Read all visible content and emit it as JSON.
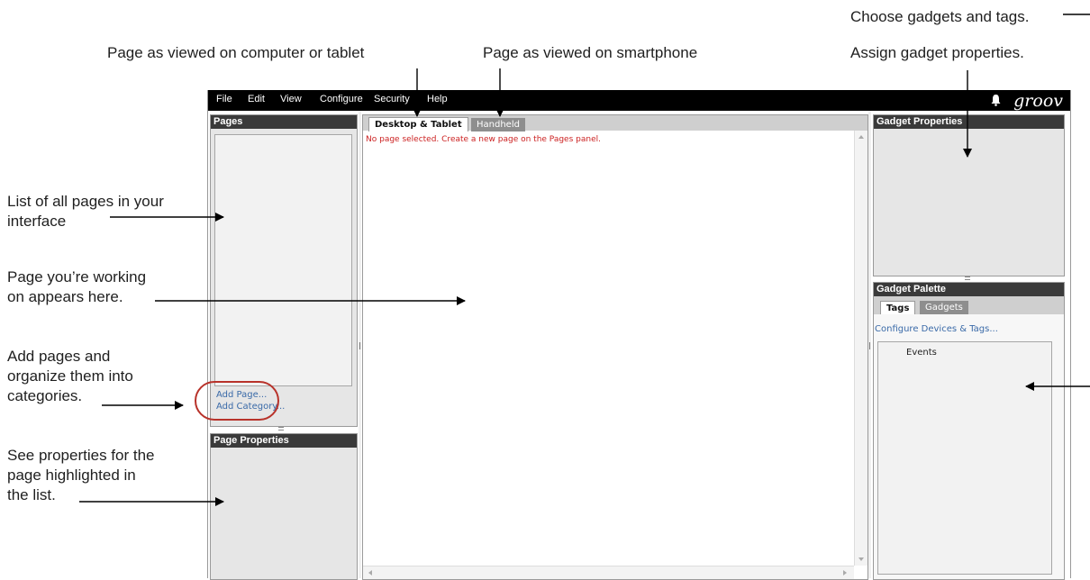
{
  "annotations": {
    "choose_gadgets": "Choose gadgets and tags.",
    "page_computer": "Page as viewed on computer or tablet",
    "page_smartphone": "Page as viewed on smartphone",
    "assign_props": "Assign gadget properties.",
    "list_pages_1": "List of all pages in your",
    "list_pages_2": "interface",
    "working_1": "Page you’re working",
    "working_2": "on appears here.",
    "add_pages_1": "Add pages and",
    "add_pages_2": "organize them into",
    "add_pages_3": "categories.",
    "see_props_1": "See properties for the",
    "see_props_2": "page highlighted in",
    "see_props_3": "the list."
  },
  "menubar": {
    "items": [
      "File",
      "Edit",
      "View",
      "Configure",
      "Security",
      "Help"
    ],
    "logo": "groov"
  },
  "pages_panel": {
    "title": "Pages",
    "add_page": "Add Page...",
    "add_category": "Add Category..."
  },
  "page_properties_panel": {
    "title": "Page Properties"
  },
  "editor": {
    "tab_desktop": "Desktop & Tablet",
    "tab_handheld": "Handheld",
    "message": "No page selected. Create a new page on the Pages panel."
  },
  "gadget_properties_panel": {
    "title": "Gadget Properties"
  },
  "gadget_palette": {
    "title": "Gadget Palette",
    "tab_tags": "Tags",
    "tab_gadgets": "Gadgets",
    "configure_link": "Configure Devices & Tags...",
    "tree_item": "Events"
  },
  "colors": {
    "menubar": "#000000",
    "panel_header": "#3a3a3a",
    "link": "#3a6aa8",
    "message": "#cc2222",
    "highlight_circle": "#b8322a"
  }
}
